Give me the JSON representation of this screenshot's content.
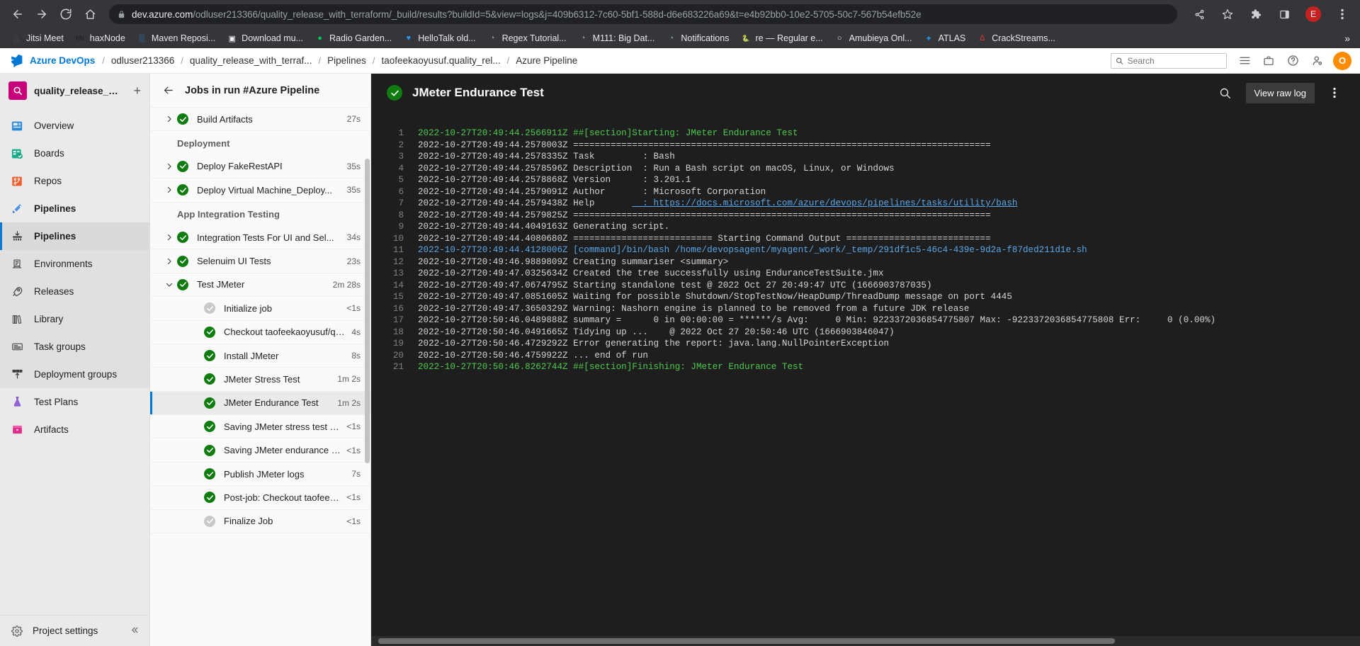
{
  "browser": {
    "url_host": "dev.azure.com",
    "url_path": "/odluser213366/quality_release_with_terraform/_build/results?buildId=5&view=logs&j=409b6312-7c60-5bf1-588d-d6e683226a69&t=e4b92bb0-10e2-5705-50c7-567b54efb52e",
    "profile_initial": "E",
    "bookmarks": [
      {
        "label": "Jitsi Meet",
        "icon": "jitsi-icon",
        "color": "#4a4a4a",
        "glyph": "△"
      },
      {
        "label": "haxNode",
        "icon": "haxnode-icon",
        "color": "#1b1b1b",
        "glyph": "hN"
      },
      {
        "label": "Maven Reposi...",
        "icon": "maven-icon",
        "color": "#2f6faf",
        "glyph": "▒"
      },
      {
        "label": "Download mu...",
        "icon": "download-music-icon",
        "color": "#f2f2f2",
        "glyph": "▣"
      },
      {
        "label": "Radio Garden...",
        "icon": "radio-garden-icon",
        "color": "#00c853",
        "glyph": "●"
      },
      {
        "label": "HelloTalk old...",
        "icon": "hellotalk-icon",
        "color": "#2196f3",
        "glyph": "♥"
      },
      {
        "label": "Regex Tutorial...",
        "icon": "globe-icon",
        "color": "#9aa0a6",
        "glyph": "◔"
      },
      {
        "label": "M111: Big Dat...",
        "icon": "globe-icon",
        "color": "#9aa0a6",
        "glyph": "◔"
      },
      {
        "label": "Notifications",
        "icon": "globe-icon",
        "color": "#9aa0a6",
        "glyph": "◔"
      },
      {
        "label": "re — Regular e...",
        "icon": "python-icon",
        "color": "#ffd43b",
        "glyph": "🐍"
      },
      {
        "label": "Amubieya Onl...",
        "icon": "flame-icon",
        "color": "#e8eaed",
        "glyph": "○"
      },
      {
        "label": "ATLAS",
        "icon": "atlas-icon",
        "color": "#2196f3",
        "glyph": "✦"
      },
      {
        "label": "CrackStreams...",
        "icon": "crackstreams-icon",
        "color": "#e53935",
        "glyph": "Δ"
      }
    ],
    "overflow_label": "»"
  },
  "header": {
    "brand": "Azure DevOps",
    "breadcrumbs": [
      "odluser213366",
      "quality_release_with_terraf...",
      "Pipelines",
      "taofeekaoyusuf.quality_rel...",
      "Azure Pipeline"
    ],
    "search_placeholder": "Search",
    "avatar_initial": "O",
    "icons": [
      "list-icon",
      "briefcase-icon",
      "help-icon",
      "user-settings-icon"
    ]
  },
  "sidebar": {
    "project_name": "quality_release_with_t...",
    "project_icon": "search-badge-icon",
    "add_label": "+",
    "items": [
      {
        "label": "Overview",
        "icon": "overview-icon",
        "active": false,
        "bold": false,
        "sub": false
      },
      {
        "label": "Boards",
        "icon": "boards-icon",
        "active": false,
        "bold": false,
        "sub": false
      },
      {
        "label": "Repos",
        "icon": "repos-icon",
        "active": false,
        "bold": false,
        "sub": false
      },
      {
        "label": "Pipelines",
        "icon": "pipelines-icon",
        "active": false,
        "bold": true,
        "sub": false
      },
      {
        "label": "Pipelines",
        "icon": "pipelines-sub-icon",
        "active": true,
        "bold": true,
        "sub": true
      },
      {
        "label": "Environments",
        "icon": "environments-icon",
        "active": false,
        "bold": false,
        "sub": true
      },
      {
        "label": "Releases",
        "icon": "releases-icon",
        "active": false,
        "bold": false,
        "sub": true
      },
      {
        "label": "Library",
        "icon": "library-icon",
        "active": false,
        "bold": false,
        "sub": true
      },
      {
        "label": "Task groups",
        "icon": "task-groups-icon",
        "active": false,
        "bold": false,
        "sub": true
      },
      {
        "label": "Deployment groups",
        "icon": "deployment-groups-icon",
        "active": false,
        "bold": false,
        "sub": true
      },
      {
        "label": "Test Plans",
        "icon": "test-plans-icon",
        "active": false,
        "bold": false,
        "sub": false
      },
      {
        "label": "Artifacts",
        "icon": "artifacts-icon",
        "active": false,
        "bold": false,
        "sub": false
      }
    ],
    "project_settings_label": "Project settings",
    "project_settings_icon": "gear-icon",
    "collapse_icon": "collapse-icon"
  },
  "jobs_panel": {
    "title": "Jobs in run #Azure Pipeline",
    "back_icon": "back-arrow-icon",
    "rows": [
      {
        "type": "job",
        "label": "Build Artifacts",
        "time": "27s",
        "status": "succeeded",
        "expandable": true,
        "expanded": false,
        "selected": false
      },
      {
        "type": "group",
        "label": "Deployment"
      },
      {
        "type": "job",
        "label": "Deploy FakeRestAPI",
        "time": "35s",
        "status": "succeeded",
        "expandable": true,
        "expanded": false,
        "selected": false
      },
      {
        "type": "job",
        "label": "Deploy Virtual Machine_Deploy...",
        "time": "35s",
        "status": "succeeded",
        "expandable": true,
        "expanded": false,
        "selected": false
      },
      {
        "type": "group",
        "label": "App Integration Testing"
      },
      {
        "type": "job",
        "label": "Integration Tests For UI and Sel...",
        "time": "34s",
        "status": "succeeded",
        "expandable": true,
        "expanded": false,
        "selected": false
      },
      {
        "type": "job",
        "label": "Selenuim UI Tests",
        "time": "23s",
        "status": "succeeded",
        "expandable": true,
        "expanded": false,
        "selected": false
      },
      {
        "type": "job",
        "label": "Test JMeter",
        "time": "2m 28s",
        "status": "succeeded",
        "expandable": true,
        "expanded": true,
        "selected": false
      },
      {
        "type": "task",
        "label": "Initialize job",
        "time": "<1s",
        "status": "skipped",
        "selected": false
      },
      {
        "type": "task",
        "label": "Checkout taofeekaoyusuf/qual...",
        "time": "4s",
        "status": "succeeded",
        "selected": false
      },
      {
        "type": "task",
        "label": "Install JMeter",
        "time": "8s",
        "status": "succeeded",
        "selected": false
      },
      {
        "type": "task",
        "label": "JMeter Stress Test",
        "time": "1m 2s",
        "status": "succeeded",
        "selected": false
      },
      {
        "type": "task",
        "label": "JMeter Endurance Test",
        "time": "1m 2s",
        "status": "succeeded",
        "selected": true
      },
      {
        "type": "task",
        "label": "Saving JMeter stress test rep...",
        "time": "<1s",
        "status": "succeeded",
        "selected": false
      },
      {
        "type": "task",
        "label": "Saving JMeter endurance tes...",
        "time": "<1s",
        "status": "succeeded",
        "selected": false
      },
      {
        "type": "task",
        "label": "Publish JMeter logs",
        "time": "7s",
        "status": "succeeded",
        "selected": false
      },
      {
        "type": "task",
        "label": "Post-job: Checkout taofeeka...",
        "time": "<1s",
        "status": "succeeded",
        "selected": false
      },
      {
        "type": "task",
        "label": "Finalize Job",
        "time": "<1s",
        "status": "skipped",
        "selected": false
      }
    ]
  },
  "log": {
    "title": "JMeter Endurance Test",
    "status": "succeeded",
    "search_icon": "search-icon",
    "raw_log_label": "View raw log",
    "more_icon": "more-vertical-icon",
    "lines": [
      {
        "n": "1",
        "text": "2022-10-27T20:49:44.2566911Z ##[section]Starting: JMeter Endurance Test",
        "style": "green"
      },
      {
        "n": "2",
        "text": "2022-10-27T20:49:44.2578003Z ==============================================================================",
        "style": "normal"
      },
      {
        "n": "3",
        "text": "2022-10-27T20:49:44.2578335Z Task         : Bash",
        "style": "normal"
      },
      {
        "n": "4",
        "text": "2022-10-27T20:49:44.2578596Z Description  : Run a Bash script on macOS, Linux, or Windows",
        "style": "normal"
      },
      {
        "n": "5",
        "text": "2022-10-27T20:49:44.2578868Z Version      : 3.201.1",
        "style": "normal"
      },
      {
        "n": "6",
        "text": "2022-10-27T20:49:44.2579091Z Author       : Microsoft Corporation",
        "style": "normal"
      },
      {
        "n": "7",
        "text": "2022-10-27T20:49:44.2579438Z Help         : https://docs.microsoft.com/azure/devops/pipelines/tasks/utility/bash",
        "style": "link",
        "link_start": 40
      },
      {
        "n": "8",
        "text": "2022-10-27T20:49:44.2579825Z ==============================================================================",
        "style": "normal"
      },
      {
        "n": "9",
        "text": "2022-10-27T20:49:44.4049163Z Generating script.",
        "style": "normal"
      },
      {
        "n": "10",
        "text": "2022-10-27T20:49:44.4080680Z ========================== Starting Command Output ===========================",
        "style": "normal"
      },
      {
        "n": "11",
        "text": "2022-10-27T20:49:44.4128006Z [command]/bin/bash /home/devopsagent/myagent/_work/_temp/291df1c5-46c4-439e-9d2a-f87ded211d1e.sh",
        "style": "blue"
      },
      {
        "n": "12",
        "text": "2022-10-27T20:49:46.9889809Z Creating summariser <summary>",
        "style": "normal"
      },
      {
        "n": "13",
        "text": "2022-10-27T20:49:47.0325634Z Created the tree successfully using EnduranceTestSuite.jmx",
        "style": "normal"
      },
      {
        "n": "14",
        "text": "2022-10-27T20:49:47.0674795Z Starting standalone test @ 2022 Oct 27 20:49:47 UTC (1666903787035)",
        "style": "normal"
      },
      {
        "n": "15",
        "text": "2022-10-27T20:49:47.0851605Z Waiting for possible Shutdown/StopTestNow/HeapDump/ThreadDump message on port 4445",
        "style": "normal"
      },
      {
        "n": "16",
        "text": "2022-10-27T20:49:47.3650329Z Warning: Nashorn engine is planned to be removed from a future JDK release",
        "style": "normal"
      },
      {
        "n": "17",
        "text": "2022-10-27T20:50:46.0489888Z summary =      0 in 00:00:00 = ******/s Avg:     0 Min: 9223372036854775807 Max: -9223372036854775808 Err:     0 (0.00%)",
        "style": "normal"
      },
      {
        "n": "18",
        "text": "2022-10-27T20:50:46.0491665Z Tidying up ...    @ 2022 Oct 27 20:50:46 UTC (1666903846047)",
        "style": "normal"
      },
      {
        "n": "19",
        "text": "2022-10-27T20:50:46.4729292Z Error generating the report: java.lang.NullPointerException",
        "style": "normal"
      },
      {
        "n": "20",
        "text": "2022-10-27T20:50:46.4759922Z ... end of run",
        "style": "normal"
      },
      {
        "n": "21",
        "text": "2022-10-27T20:50:46.8262744Z ##[section]Finishing: JMeter Endurance Test",
        "style": "green"
      }
    ]
  }
}
